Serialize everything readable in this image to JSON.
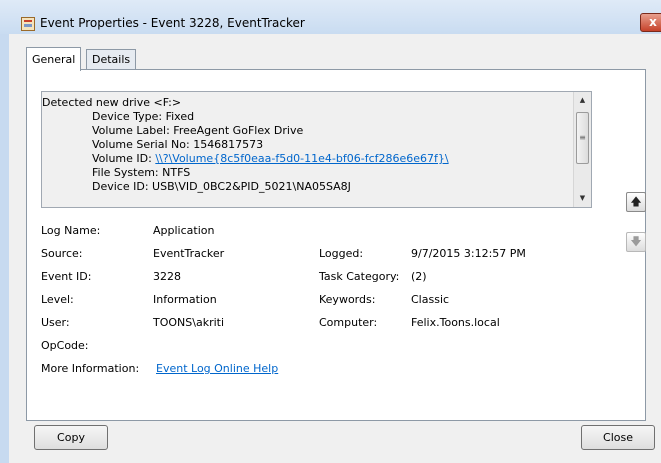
{
  "window": {
    "title": "Event Properties - Event 3228, EventTracker",
    "close_glyph": "x"
  },
  "tabs": [
    {
      "label": "General"
    },
    {
      "label": "Details"
    }
  ],
  "description": {
    "line1": "Detected new drive <F:>",
    "line2": "Device Type: Fixed",
    "line3": "Volume Label: FreeAgent GoFlex Drive",
    "line4": "Volume Serial No: 1546817573",
    "line5_prefix": "Volume ID: ",
    "line5_link": "\\\\?\\Volume{8c5f0eaa-f5d0-11e4-bf06-fcf286e6e67f}\\",
    "line6": "File System: NTFS",
    "line7": "Device ID: USB\\VID_0BC2&PID_5021\\NA05SA8J"
  },
  "fields": {
    "log_name_label": "Log Name:",
    "log_name_value": "Application",
    "source_label": "Source:",
    "source_value": "EventTracker",
    "logged_label": "Logged:",
    "logged_value": "9/7/2015 3:12:57 PM",
    "event_id_label": "Event ID:",
    "event_id_value": "3228",
    "task_category_label": "Task Category:",
    "task_category_value": "(2)",
    "level_label": "Level:",
    "level_value": "Information",
    "keywords_label": "Keywords:",
    "keywords_value": "Classic",
    "user_label": "User:",
    "user_value": "TOONS\\akriti",
    "computer_label": "Computer:",
    "computer_value": "Felix.Toons.local",
    "opcode_label": "OpCode:",
    "opcode_value": "",
    "more_info_label": "More Information:",
    "more_info_link": "Event Log Online Help"
  },
  "buttons": {
    "copy": "Copy",
    "close": "Close"
  },
  "icons": {
    "app": "event-viewer-icon",
    "nav_up": "up-arrow-icon",
    "nav_down": "down-arrow-icon",
    "scroll_up_glyph": "▲",
    "scroll_down_glyph": "▼",
    "thumb_glyph": "≡",
    "nav_up_glyph": "🡅",
    "nav_down_glyph": "🡇"
  }
}
